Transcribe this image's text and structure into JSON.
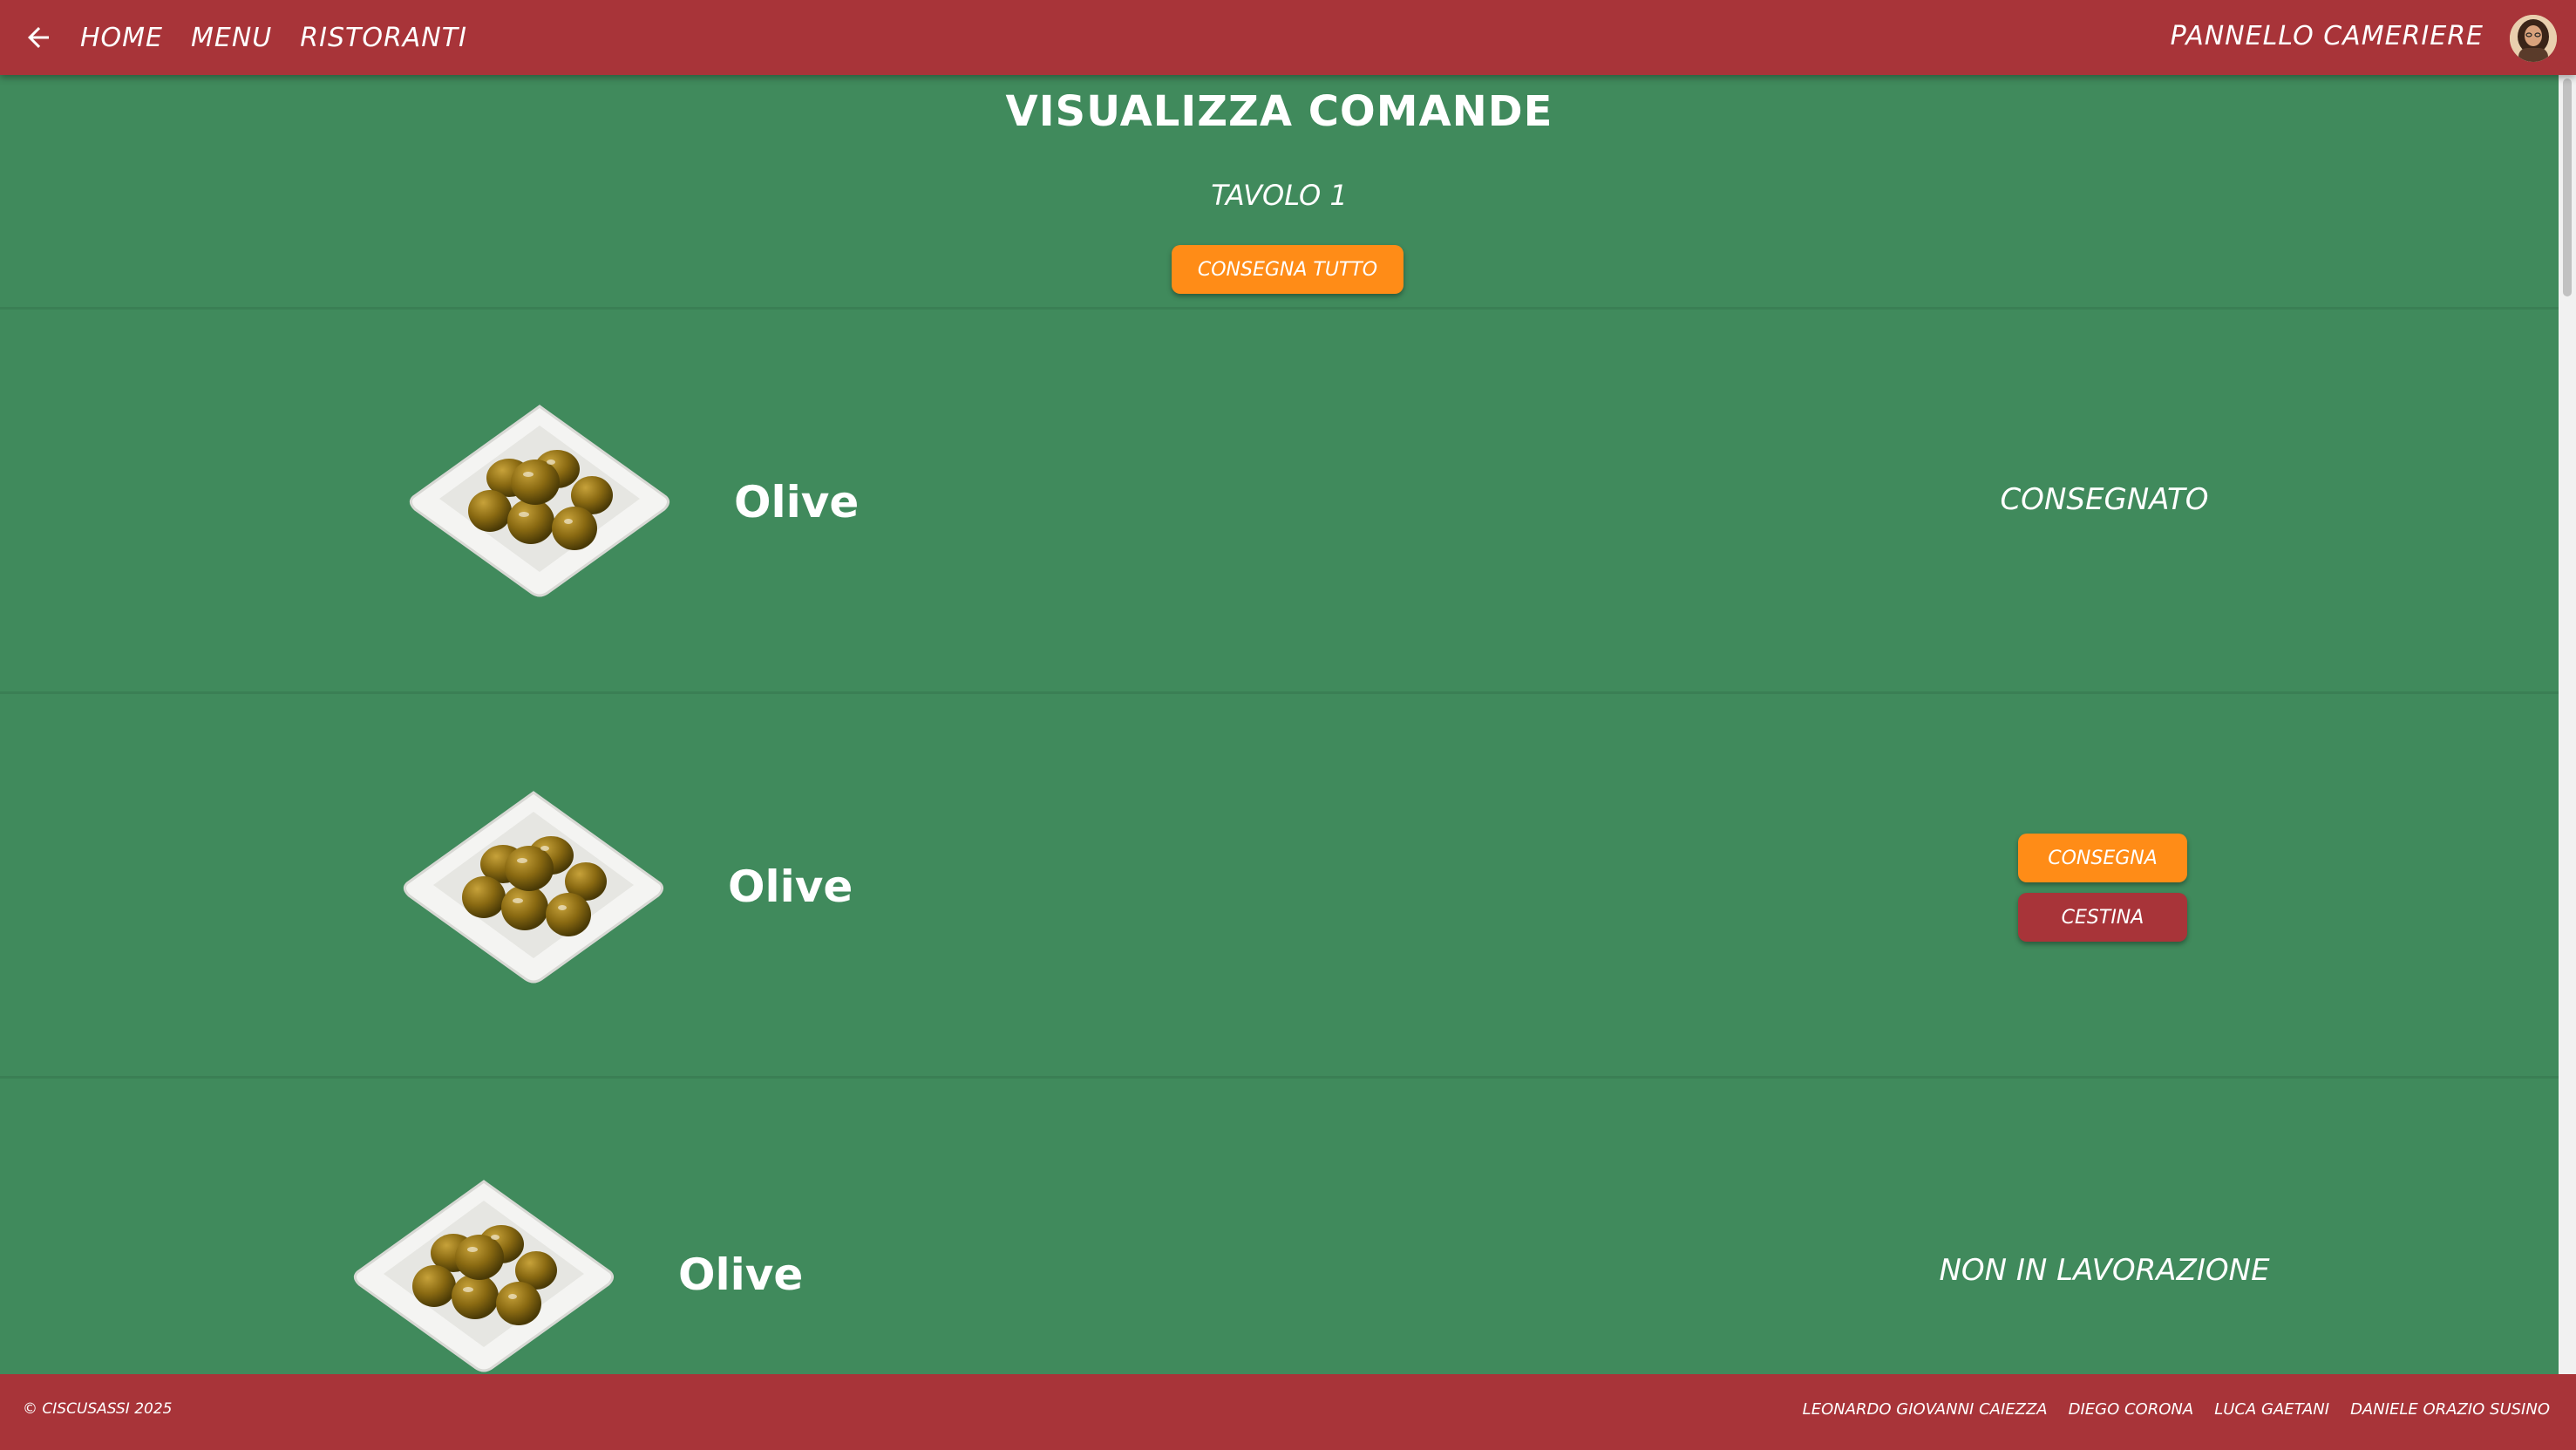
{
  "header": {
    "nav": [
      "HOME",
      "MENU",
      "RISTORANTI"
    ],
    "panel_label": "PANNELLO CAMERIERE"
  },
  "page": {
    "title": "VISUALIZZA COMANDE",
    "table": "TAVOLO 1",
    "deliver_all_label": "CONSEGNA TUTTO"
  },
  "orders": [
    {
      "dish": "Olive",
      "status": "CONSEGNATO"
    },
    {
      "dish": "Olive",
      "actions": {
        "deliver": "CONSEGNA",
        "trash": "CESTINA"
      }
    },
    {
      "dish": "Olive",
      "status": "NON IN LAVORAZIONE"
    }
  ],
  "footer": {
    "copyright": "© CISCUSASSI 2025",
    "authors": [
      "LEONARDO GIOVANNI CAIEZZA",
      "DIEGO CORONA",
      "LUCA GAETANI",
      "DANIELE ORAZIO SUSINO"
    ]
  },
  "colors": {
    "background": "#408a5c",
    "bar": "#a83439",
    "accent": "#ff8c17"
  },
  "icons": {
    "back": "arrow-left-icon",
    "avatar": "user-avatar"
  }
}
